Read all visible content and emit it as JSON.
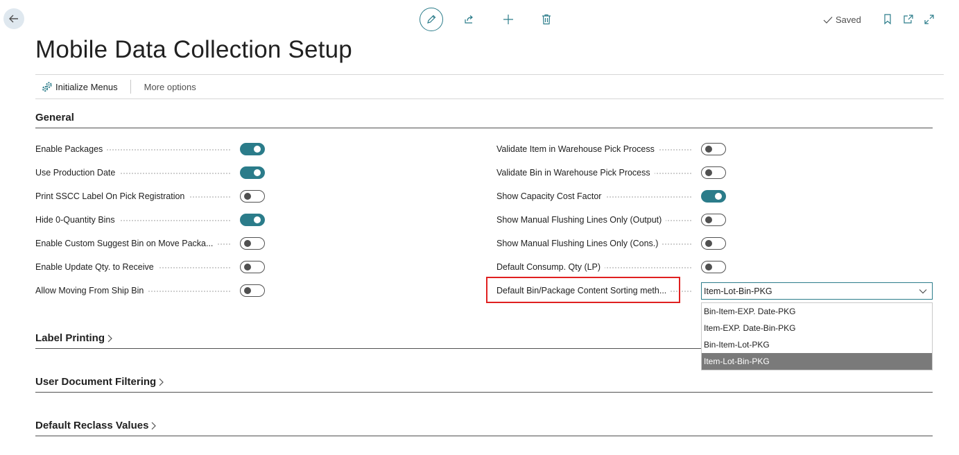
{
  "header": {
    "saved_label": "Saved",
    "title": "Mobile Data Collection Setup",
    "icons": [
      "back-arrow-icon",
      "pencil-icon",
      "share-icon",
      "plus-icon",
      "trash-icon",
      "checkmark-icon",
      "bookmark-icon",
      "open-new-window-icon",
      "expand-icon"
    ]
  },
  "action_bar": {
    "initialize_menus": "Initialize Menus",
    "more_options": "More options"
  },
  "sections": {
    "general": "General",
    "label_printing": "Label Printing",
    "user_document_filtering": "User Document Filtering",
    "default_reclass_values": "Default Reclass Values"
  },
  "left_fields": [
    {
      "label": "Enable Packages",
      "value": true
    },
    {
      "label": "Use Production Date",
      "value": true
    },
    {
      "label": "Print SSCC Label On Pick Registration",
      "value": false
    },
    {
      "label": "Hide 0-Quantity Bins",
      "value": true
    },
    {
      "label": "Enable Custom Suggest Bin on Move Packa...",
      "value": false
    },
    {
      "label": "Enable Update Qty. to Receive",
      "value": false
    },
    {
      "label": "Allow Moving From Ship Bin",
      "value": false
    }
  ],
  "right_fields": [
    {
      "label": "Validate Item in Warehouse Pick Process",
      "value": false
    },
    {
      "label": "Validate Bin in Warehouse Pick Process",
      "value": false
    },
    {
      "label": "Show Capacity Cost Factor",
      "value": true
    },
    {
      "label": "Show Manual Flushing Lines Only (Output)",
      "value": false
    },
    {
      "label": "Show Manual Flushing Lines Only (Cons.)",
      "value": false
    },
    {
      "label": "Default Consump. Qty (LP)",
      "value": false
    }
  ],
  "sorting_field": {
    "label": "Default Bin/Package Content Sorting meth...",
    "value": "Item-Lot-Bin-PKG",
    "options": [
      "Bin-Item-EXP. Date-PKG",
      "Item-EXP. Date-Bin-PKG",
      "Bin-Item-Lot-PKG",
      "Item-Lot-Bin-PKG"
    ],
    "selected_index": 3
  },
  "colors": {
    "accent": "#2b7c8a",
    "highlight": "#e02020",
    "selected_option_bg": "#7a7a7a"
  }
}
